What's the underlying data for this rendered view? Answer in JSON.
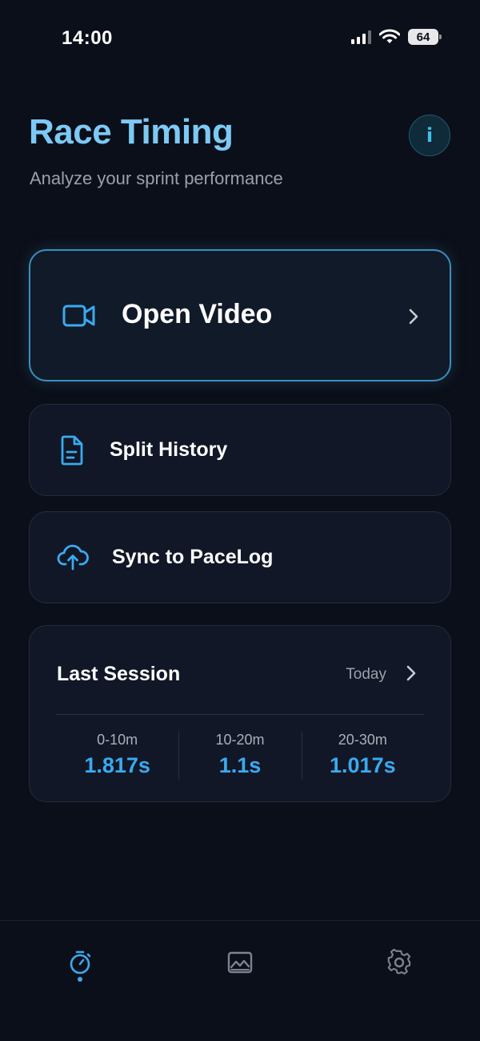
{
  "status_bar": {
    "time": "14:00",
    "battery": "64",
    "icons": [
      "signal-icon",
      "wifi-icon",
      "battery-icon"
    ]
  },
  "header": {
    "title": "Race Timing",
    "subtitle": "Analyze your sprint performance",
    "info_label": "i"
  },
  "actions": {
    "open_video": {
      "label": "Open Video",
      "icon": "video-camera-icon"
    },
    "split_history": {
      "label": "Split History",
      "icon": "document-icon"
    },
    "sync": {
      "label": "Sync to PaceLog",
      "icon": "cloud-upload-icon"
    }
  },
  "last_session": {
    "title": "Last Session",
    "date": "Today",
    "splits": [
      {
        "range": "0-10m",
        "time": "1.817s"
      },
      {
        "range": "10-20m",
        "time": "1.1s"
      },
      {
        "range": "20-30m",
        "time": "1.017s"
      }
    ]
  },
  "tabs": [
    {
      "name": "timer",
      "icon": "stopwatch-icon",
      "active": true
    },
    {
      "name": "gallery",
      "icon": "image-icon",
      "active": false
    },
    {
      "name": "settings",
      "icon": "gear-icon",
      "active": false
    }
  ],
  "colors": {
    "background": "#0b0f19",
    "card": "#111726",
    "accent": "#3aaaf0",
    "title": "#7cc9f4",
    "muted": "#9aa0aa"
  }
}
